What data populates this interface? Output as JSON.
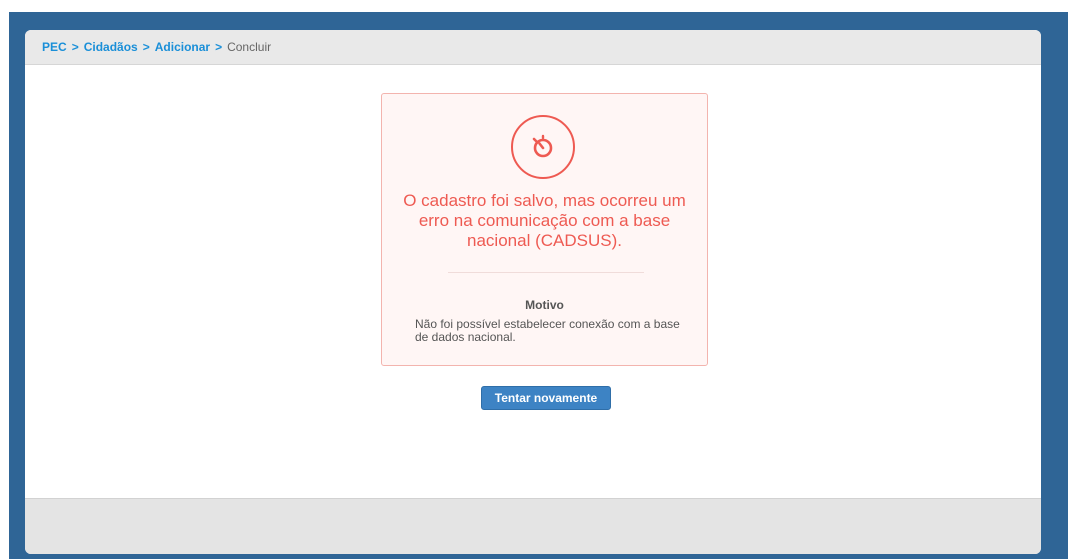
{
  "breadcrumb": {
    "items": [
      "PEC",
      "Cidadãos",
      "Adicionar"
    ],
    "separator": ">",
    "current": "Concluir"
  },
  "error": {
    "icon": "stopwatch-alert-icon",
    "title": "O cadastro foi salvo, mas ocorreu um erro na comunicação com a base nacional (CADSUS).",
    "reason_label": "Motivo",
    "reason_text": "Não foi possível estabelecer conexão com a base de dados nacional."
  },
  "actions": {
    "retry_label": "Tentar novamente"
  },
  "colors": {
    "frame": "#2f6596",
    "link": "#1a8fd8",
    "error": "#ee5a52",
    "button": "#3d83c4"
  }
}
